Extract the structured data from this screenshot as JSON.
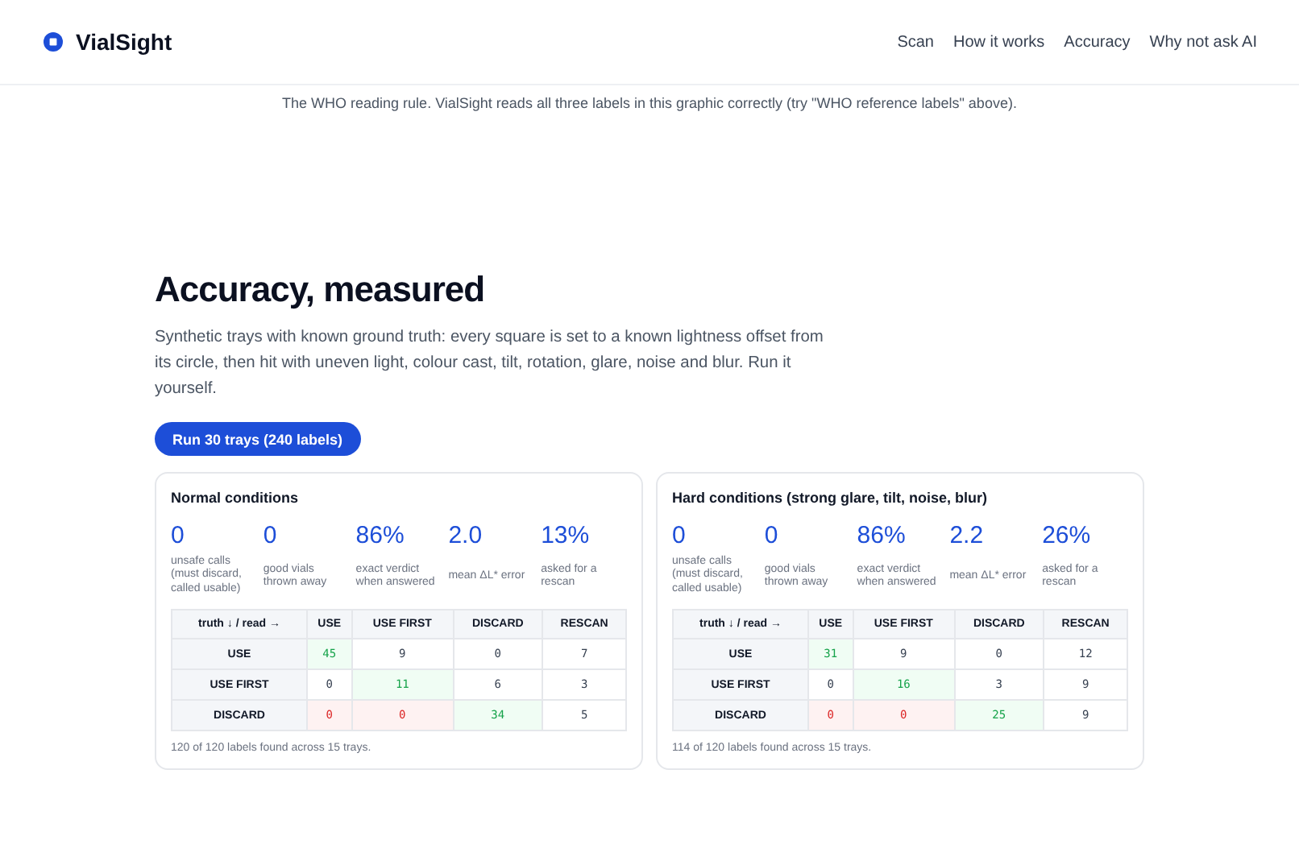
{
  "nav": {
    "brand": "VialSight",
    "links": [
      "Scan",
      "How it works",
      "Accuracy",
      "Why not ask AI"
    ]
  },
  "caption": "The WHO reading rule. VialSight reads all three labels in this graphic correctly (try \"WHO reference labels\" above).",
  "section": {
    "title": "Accuracy, measured",
    "intro": "Synthetic trays with known ground truth: every square is set to a known lightness offset from its circle, then hit with uneven light, colour cast, tilt, rotation, glare, noise and blur. Run it yourself.",
    "button": "Run 30 trays (240 labels)"
  },
  "cards": [
    {
      "title": "Normal conditions",
      "stats": [
        {
          "value": "0",
          "label": "unsafe calls (must discard, called usable)"
        },
        {
          "value": "0",
          "label": "good vials thrown away"
        },
        {
          "value": "86%",
          "label": "exact verdict when answered"
        },
        {
          "value": "2.0",
          "label": "mean ΔL* error"
        },
        {
          "value": "13%",
          "label": "asked for a rescan"
        }
      ],
      "corner": "truth ↓ / read →",
      "columns": [
        "USE",
        "USE FIRST",
        "DISCARD",
        "RESCAN"
      ],
      "rows": [
        {
          "label": "USE",
          "cells": [
            {
              "text": "45",
              "kind": "correct"
            },
            {
              "text": "9",
              "kind": "plain"
            },
            {
              "text": "0",
              "kind": "plain"
            },
            {
              "text": "7",
              "kind": "plain"
            }
          ]
        },
        {
          "label": "USE FIRST",
          "cells": [
            {
              "text": "0",
              "kind": "plain"
            },
            {
              "text": "11",
              "kind": "correct"
            },
            {
              "text": "6",
              "kind": "plain"
            },
            {
              "text": "3",
              "kind": "plain"
            }
          ]
        },
        {
          "label": "DISCARD",
          "cells": [
            {
              "text": "0",
              "kind": "unsafe"
            },
            {
              "text": "0",
              "kind": "unsafe"
            },
            {
              "text": "34",
              "kind": "correct"
            },
            {
              "text": "5",
              "kind": "plain"
            }
          ]
        }
      ],
      "footnote": "120 of 120 labels found across 15 trays."
    },
    {
      "title": "Hard conditions (strong glare, tilt, noise, blur)",
      "stats": [
        {
          "value": "0",
          "label": "unsafe calls (must discard, called usable)"
        },
        {
          "value": "0",
          "label": "good vials thrown away"
        },
        {
          "value": "86%",
          "label": "exact verdict when answered"
        },
        {
          "value": "2.2",
          "label": "mean ΔL* error"
        },
        {
          "value": "26%",
          "label": "asked for a rescan"
        }
      ],
      "corner": "truth ↓ / read →",
      "columns": [
        "USE",
        "USE FIRST",
        "DISCARD",
        "RESCAN"
      ],
      "rows": [
        {
          "label": "USE",
          "cells": [
            {
              "text": "31",
              "kind": "correct"
            },
            {
              "text": "9",
              "kind": "plain"
            },
            {
              "text": "0",
              "kind": "plain"
            },
            {
              "text": "12",
              "kind": "plain"
            }
          ]
        },
        {
          "label": "USE FIRST",
          "cells": [
            {
              "text": "0",
              "kind": "plain"
            },
            {
              "text": "16",
              "kind": "correct"
            },
            {
              "text": "3",
              "kind": "plain"
            },
            {
              "text": "9",
              "kind": "plain"
            }
          ]
        },
        {
          "label": "DISCARD",
          "cells": [
            {
              "text": "0",
              "kind": "unsafe"
            },
            {
              "text": "0",
              "kind": "unsafe"
            },
            {
              "text": "25",
              "kind": "correct"
            },
            {
              "text": "9",
              "kind": "plain"
            }
          ]
        }
      ],
      "footnote": "114 of 120 labels found across 15 trays."
    }
  ]
}
